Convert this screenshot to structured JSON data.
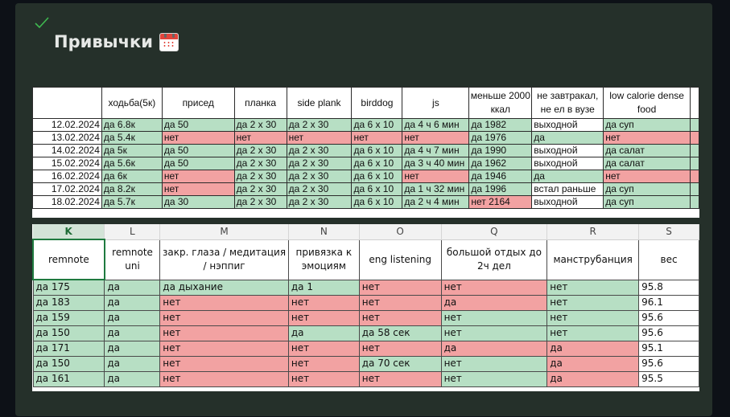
{
  "page": {
    "title": "Привычки",
    "title_icon": "calendar-icon",
    "check_icon": "checkmark-icon"
  },
  "colors": {
    "green": "#b7dfc4",
    "red": "#f2a2a2",
    "white": "#ffffff",
    "selected_col": "#1f7a3f"
  },
  "table1": {
    "headers": [
      "",
      "ходьба(5к)",
      "присед",
      "планка",
      "side plank",
      "birddog",
      "js",
      "меньше 2000 ккал",
      "не завтракал, не ел в вузе",
      "low calorie dense food",
      ""
    ],
    "rows": [
      {
        "cells": [
          "12.02.2024",
          "да 6.8к",
          "да 50",
          "да 2 х 30",
          "да 2 х 30",
          "да 6 х 10",
          "да 4 ч 6 мин",
          "да 1982",
          "выходной",
          "да суп",
          ""
        ],
        "colors": [
          "w",
          "g",
          "g",
          "g",
          "g",
          "g",
          "g",
          "g",
          "w",
          "g",
          "g"
        ]
      },
      {
        "cells": [
          "13.02.2024",
          "да 5.4к",
          "нет",
          "нет",
          "нет",
          "нет",
          "нет",
          "да 1976",
          "да",
          "нет",
          ""
        ],
        "colors": [
          "w",
          "g",
          "r",
          "r",
          "r",
          "r",
          "r",
          "g",
          "g",
          "r",
          "r"
        ]
      },
      {
        "cells": [
          "14.02.2024",
          "да 5к",
          "да 50",
          "да 2 х 30",
          "да 2 х 30",
          "да 6 х 10",
          "да 4 ч 7 мин",
          "да 1990",
          "выходной",
          "да салат",
          ""
        ],
        "colors": [
          "w",
          "g",
          "g",
          "g",
          "g",
          "g",
          "g",
          "g",
          "w",
          "g",
          "g"
        ]
      },
      {
        "cells": [
          "15.02.2024",
          "да 5.6к",
          "да 50",
          "да 2 х 30",
          "да 2 х 30",
          "да 6 х 10",
          "да 3 ч 40 мин",
          "да 1962",
          "выходной",
          "да салат",
          ""
        ],
        "colors": [
          "w",
          "g",
          "g",
          "g",
          "g",
          "g",
          "g",
          "g",
          "w",
          "g",
          "g"
        ]
      },
      {
        "cells": [
          "16.02.2024",
          "да 6к",
          "нет",
          "да 2 х 30",
          "да 2 х 30",
          "да 6 х 10",
          "нет",
          "да 1946",
          "да",
          "нет",
          ""
        ],
        "colors": [
          "w",
          "g",
          "r",
          "g",
          "g",
          "g",
          "r",
          "g",
          "g",
          "r",
          "r"
        ]
      },
      {
        "cells": [
          "17.02.2024",
          "да 8.2к",
          "нет",
          "да 2 х 30",
          "да 2 х 30",
          "да 6 х 10",
          "да 1 ч 32 мин",
          "да 1996",
          "встал раньше",
          "да суп",
          ""
        ],
        "colors": [
          "w",
          "g",
          "r",
          "g",
          "g",
          "g",
          "g",
          "g",
          "w",
          "g",
          "g"
        ]
      },
      {
        "cells": [
          "18.02.2024",
          "да 5.7к",
          "да 30",
          "да 2 х 30",
          "да 2 х 30",
          "да 6 х 10",
          "да 2 ч 4 мин",
          "нет 2164",
          "выходной",
          "да суп",
          ""
        ],
        "colors": [
          "w",
          "g",
          "g",
          "g",
          "g",
          "g",
          "g",
          "r",
          "w",
          "g",
          "g"
        ]
      }
    ]
  },
  "table2": {
    "column_letters": [
      "K",
      "L",
      "M",
      "N",
      "O",
      "Q",
      "R",
      "S"
    ],
    "selected_letter": "K",
    "headers": [
      "remnote",
      "remnote uni",
      "закр. глаза / медитация / нэппиг",
      "привязка к эмоциям",
      "eng listening",
      "большой отдых до 2ч дел",
      "манструбанция",
      "вес"
    ],
    "rows": [
      {
        "cells": [
          "да 175",
          "да",
          "да дыхание",
          "да 1",
          "нет",
          "нет",
          "нет",
          "95.8"
        ],
        "colors": [
          "g",
          "g",
          "g",
          "g",
          "r",
          "r",
          "g",
          "w"
        ]
      },
      {
        "cells": [
          "да 183",
          "да",
          "нет",
          "нет",
          "нет",
          "да",
          "нет",
          "96.1"
        ],
        "colors": [
          "g",
          "g",
          "r",
          "r",
          "r",
          "r",
          "g",
          "w"
        ]
      },
      {
        "cells": [
          "да 159",
          "да",
          "нет",
          "нет",
          "нет",
          "нет",
          "нет",
          "95.6"
        ],
        "colors": [
          "g",
          "g",
          "r",
          "r",
          "r",
          "g",
          "g",
          "w"
        ]
      },
      {
        "cells": [
          "да 150",
          "да",
          "нет",
          "да",
          "да 58 сек",
          "нет",
          "нет",
          "95.6"
        ],
        "colors": [
          "g",
          "g",
          "r",
          "g",
          "g",
          "g",
          "g",
          "w"
        ]
      },
      {
        "cells": [
          "да 171",
          "да",
          "нет",
          "нет",
          "нет",
          "да",
          "да",
          "95.1"
        ],
        "colors": [
          "g",
          "g",
          "r",
          "r",
          "r",
          "r",
          "r",
          "w"
        ]
      },
      {
        "cells": [
          "да 150",
          "да",
          "нет",
          "нет",
          "да 70 сек",
          "нет",
          "да",
          "95.6"
        ],
        "colors": [
          "g",
          "g",
          "r",
          "r",
          "g",
          "g",
          "r",
          "w"
        ]
      },
      {
        "cells": [
          "да 161",
          "да",
          "нет",
          "нет",
          "нет",
          "нет",
          "да",
          "95.5"
        ],
        "colors": [
          "g",
          "g",
          "r",
          "r",
          "r",
          "g",
          "r",
          "w"
        ]
      }
    ]
  }
}
